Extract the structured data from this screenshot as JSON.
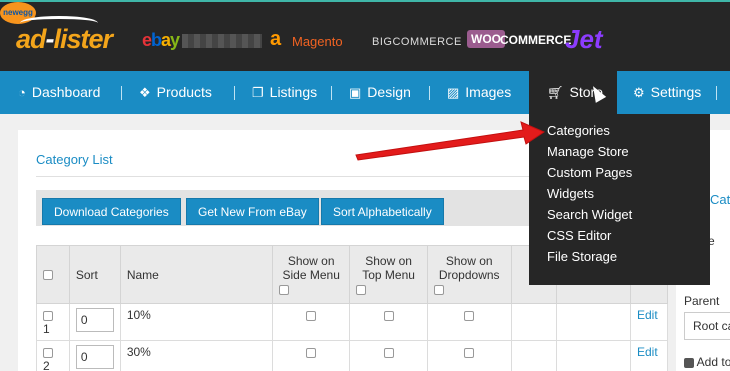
{
  "brand": {
    "logo_ad": "ad",
    "logo_dash": "-",
    "logo_lister": "lister",
    "markets": {
      "ebay": [
        "e",
        "b",
        "a",
        "y"
      ],
      "amazon": "a",
      "magento": "Magento",
      "bigcommerce": "BIGCOMMERCE",
      "woo": "WOO",
      "commerce": "COMMERCE",
      "jet": "Jet",
      "newegg": "newegg"
    }
  },
  "nav": {
    "items": [
      {
        "label": "Dashboard",
        "icon": "dashboard-icon"
      },
      {
        "label": "Products",
        "icon": "cubes-icon"
      },
      {
        "label": "Listings",
        "icon": "copy-icon"
      },
      {
        "label": "Design",
        "icon": "design-icon"
      },
      {
        "label": "Images",
        "icon": "image-icon"
      },
      {
        "label": "Store",
        "icon": "cart-icon"
      },
      {
        "label": "Settings",
        "icon": "gear-icon"
      }
    ],
    "active": "Store"
  },
  "dropdown": {
    "items": [
      "Categories",
      "Manage Store",
      "Custom Pages",
      "Widgets",
      "Search Widget",
      "CSS Editor",
      "File Storage"
    ]
  },
  "category_list": {
    "title": "Category List",
    "buttons": [
      "Download Categories",
      "Get New From eBay",
      "Sort Alphabetically"
    ],
    "columns": {
      "sort": "Sort",
      "name": "Name",
      "side_menu": [
        "Show on",
        "Side Menu"
      ],
      "top_menu": [
        "Show on",
        "Top Menu"
      ],
      "dropdowns": [
        "Show on",
        "Dropdowns"
      ]
    },
    "rows": [
      {
        "num": "1",
        "sort": "0",
        "name": "10%",
        "edit": "Edit"
      },
      {
        "num": "2",
        "sort": "0",
        "name": "30%",
        "edit": "Edit"
      }
    ]
  },
  "right_panel": {
    "heading_fragment": "Cat",
    "field_fragment": "e",
    "parent_label": "Parent",
    "parent_value": "Root ca",
    "add_to": "Add to"
  },
  "colors": {
    "accent": "#1a8cc4",
    "dark": "#262626",
    "arrow": "#e31b1b"
  }
}
